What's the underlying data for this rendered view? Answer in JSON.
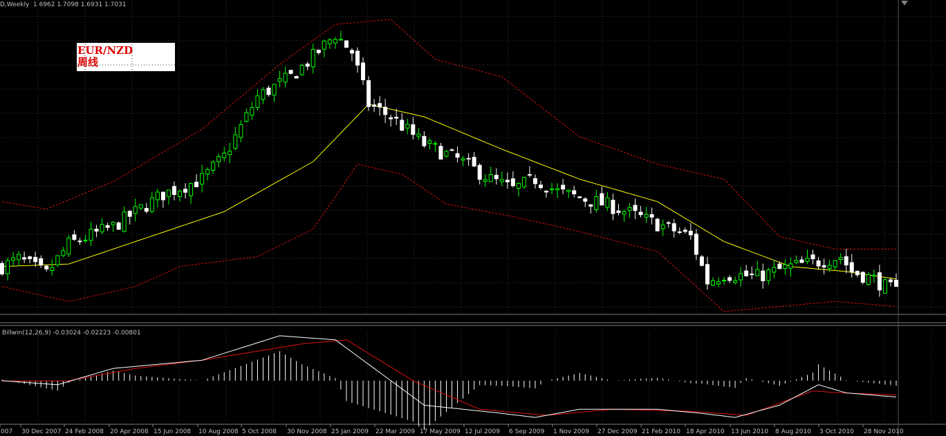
{
  "header": {
    "main_info": "D,Weekly  1.6962 1.7098 1.6931 1.7031",
    "indicator_info": "Billwin(12,26,9) -0.03024 -0.02223 -0.00801"
  },
  "label": {
    "symbol": "EUR/NZD",
    "period": "周线"
  },
  "colors": {
    "background": "#000000",
    "grid": "#3c3c3c",
    "bull_candle": "#00ff00",
    "bear_candle": "#ffffff",
    "ma": "#ffff00",
    "band": "#d01010",
    "macd": "#ffffff",
    "signal": "#e01010",
    "hist": "#ffffff",
    "axis_text": "#c0c0c0"
  },
  "chart_data": [
    {
      "type": "candlestick",
      "symbol": "EUR/NZD",
      "timeframe": "Weekly",
      "indicators": [
        "moving average (yellow)",
        "upper band (red dotted)",
        "lower band (red dotted)"
      ],
      "x_tick_labels": [
        "007",
        "30 Dec 2007",
        "24 Feb 2008",
        "20 Apr 2008",
        "15 Jun 2008",
        "10 Aug 2008",
        "5 Oct 2008",
        "30 Nov 2008",
        "25 Jan 2009",
        "22 Mar 2009",
        "17 May 2009",
        "12 Jul 2009",
        "6 Sep 2009",
        "1 Nov 2009",
        "27 Dec 2009",
        "21 Feb 2010",
        "18 Apr 2010",
        "13 Jun 2010",
        "8 Aug 2010",
        "3 Oct 2010",
        "28 Nov 2010"
      ],
      "close_keypoints": [
        [
          0,
          1.98
        ],
        [
          3,
          2.01
        ],
        [
          8,
          1.95
        ],
        [
          12,
          2.07
        ],
        [
          20,
          2.14
        ],
        [
          29,
          2.27
        ],
        [
          36,
          2.33
        ],
        [
          40,
          2.42
        ],
        [
          46,
          2.66
        ],
        [
          52,
          2.74
        ],
        [
          56,
          2.82
        ],
        [
          60,
          2.91
        ],
        [
          63,
          2.84
        ],
        [
          66,
          2.63
        ],
        [
          70,
          2.58
        ],
        [
          76,
          2.47
        ],
        [
          82,
          2.41
        ],
        [
          88,
          2.33
        ],
        [
          92,
          2.29
        ],
        [
          96,
          2.33
        ],
        [
          100,
          2.28
        ],
        [
          105,
          2.25
        ],
        [
          110,
          2.22
        ],
        [
          118,
          2.15
        ],
        [
          124,
          2.1
        ],
        [
          127,
          1.92
        ],
        [
          130,
          1.95
        ],
        [
          136,
          1.94
        ],
        [
          142,
          1.98
        ],
        [
          147,
          2.0
        ],
        [
          151,
          2.02
        ],
        [
          153,
          1.96
        ],
        [
          157,
          1.93
        ],
        [
          159,
          1.9
        ],
        [
          161,
          1.88
        ]
      ],
      "ma": [
        [
          0,
          1.98
        ],
        [
          12,
          1.99
        ],
        [
          24,
          2.08
        ],
        [
          40,
          2.2
        ],
        [
          56,
          2.4
        ],
        [
          66,
          2.63
        ],
        [
          76,
          2.58
        ],
        [
          90,
          2.45
        ],
        [
          104,
          2.33
        ],
        [
          118,
          2.24
        ],
        [
          130,
          2.08
        ],
        [
          142,
          1.98
        ],
        [
          152,
          1.96
        ],
        [
          161,
          1.93
        ]
      ],
      "upper_band": [
        [
          0,
          2.24
        ],
        [
          8,
          2.21
        ],
        [
          20,
          2.32
        ],
        [
          36,
          2.53
        ],
        [
          50,
          2.79
        ],
        [
          60,
          2.95
        ],
        [
          70,
          2.97
        ],
        [
          78,
          2.81
        ],
        [
          90,
          2.74
        ],
        [
          104,
          2.5
        ],
        [
          118,
          2.39
        ],
        [
          130,
          2.33
        ],
        [
          140,
          2.1
        ],
        [
          150,
          2.05
        ],
        [
          161,
          2.05
        ]
      ],
      "lower_band": [
        [
          0,
          1.9
        ],
        [
          12,
          1.84
        ],
        [
          24,
          1.9
        ],
        [
          32,
          1.98
        ],
        [
          46,
          2.02
        ],
        [
          56,
          2.13
        ],
        [
          64,
          2.39
        ],
        [
          72,
          2.35
        ],
        [
          80,
          2.23
        ],
        [
          92,
          2.18
        ],
        [
          104,
          2.12
        ],
        [
          118,
          2.04
        ],
        [
          130,
          1.8
        ],
        [
          140,
          1.82
        ],
        [
          150,
          1.84
        ],
        [
          161,
          1.82
        ]
      ],
      "ylim": [
        1.78,
        3.02
      ]
    },
    {
      "type": "line",
      "name": "Billwin(12,26,9)",
      "macd": [
        [
          0,
          0.0
        ],
        [
          10,
          -0.01
        ],
        [
          20,
          0.03
        ],
        [
          36,
          0.05
        ],
        [
          50,
          0.11
        ],
        [
          60,
          0.1
        ],
        [
          66,
          0.04
        ],
        [
          76,
          -0.06
        ],
        [
          90,
          -0.08
        ],
        [
          96,
          -0.09
        ],
        [
          104,
          -0.07
        ],
        [
          118,
          -0.07
        ],
        [
          126,
          -0.08
        ],
        [
          132,
          -0.09
        ],
        [
          140,
          -0.06
        ],
        [
          147,
          -0.01
        ],
        [
          152,
          -0.03
        ],
        [
          161,
          -0.04
        ]
      ],
      "signal": [
        [
          0,
          -0.001
        ],
        [
          12,
          0.0
        ],
        [
          24,
          0.03
        ],
        [
          36,
          0.05
        ],
        [
          54,
          0.09
        ],
        [
          62,
          0.1
        ],
        [
          74,
          0.0
        ],
        [
          86,
          -0.07
        ],
        [
          98,
          -0.085
        ],
        [
          110,
          -0.07
        ],
        [
          124,
          -0.075
        ],
        [
          134,
          -0.085
        ],
        [
          146,
          -0.025
        ],
        [
          151,
          -0.03
        ],
        [
          161,
          -0.035
        ]
      ],
      "hist_shown_as": "white vertical lines around zero",
      "ylim": [
        -0.1,
        0.12
      ]
    }
  ]
}
